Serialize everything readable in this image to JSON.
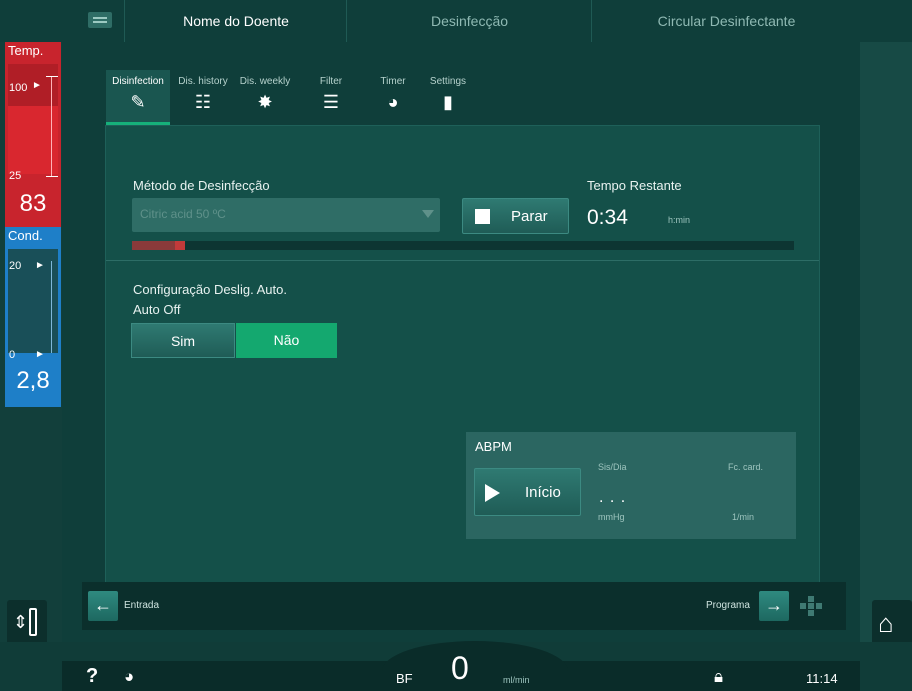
{
  "topbar": {
    "tabs": [
      "Nome do Doente",
      "Desinfecção",
      "Circular Desinfectante"
    ]
  },
  "temp": {
    "title": "Temp.",
    "scale_top": "100",
    "scale_bottom": "25",
    "value": "83"
  },
  "cond": {
    "title": "Cond.",
    "scale_top": "20",
    "scale_bottom": "0",
    "value": "2,8"
  },
  "tabs": [
    {
      "label": "Disinfection",
      "icon": "disinfection-icon"
    },
    {
      "label": "Dis. history",
      "icon": "history-icon"
    },
    {
      "label": "Dis. weekly",
      "icon": "weekly-icon"
    },
    {
      "label": "Filter",
      "icon": "filter-icon"
    },
    {
      "label": "Timer",
      "icon": "timer-icon"
    },
    {
      "label": "Settings",
      "icon": "settings-icon"
    }
  ],
  "disinfection": {
    "method_label": "Método de Desinfecção",
    "method_value": "Citric acid 50 ºC",
    "stop_label": "Parar",
    "remaining_label": "Tempo Restante",
    "remaining_value": "0:34",
    "remaining_unit": "h:min",
    "progress": 0.08
  },
  "autooff": {
    "title": "Configuração Deslig. Auto.",
    "subtitle": "Auto Off",
    "yes": "Sim",
    "no": "Não",
    "selected": "Não"
  },
  "abpm": {
    "title": "ABPM",
    "start": "Início",
    "sys_dia_label": "Sis/Dia",
    "sys_dia_value": ". . .",
    "sys_dia_unit": "mmHg",
    "hr_label": "Fc. card.",
    "hr_unit": "1/min"
  },
  "nav": {
    "back": "Entrada",
    "forward": "Programa"
  },
  "footer": {
    "bf_label": "BF",
    "bf_value": "0",
    "bf_unit": "ml/min",
    "time": "11:14"
  },
  "colors": {
    "accent_green": "#14a86f",
    "temp_red": "#c8242d",
    "cond_blue": "#1e7fc8"
  }
}
